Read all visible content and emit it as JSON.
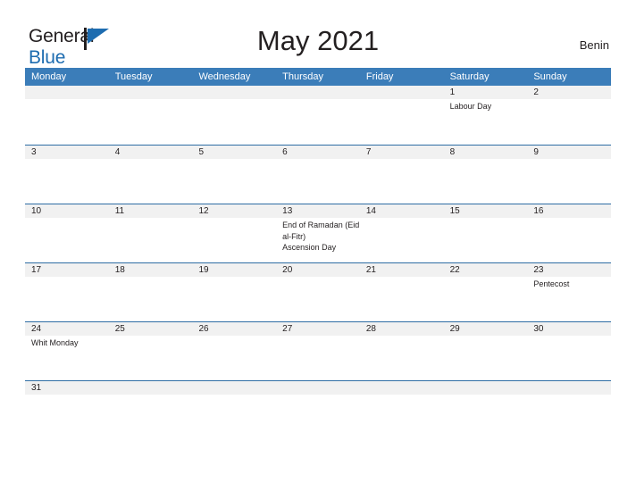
{
  "brand": {
    "name_part1": "General",
    "name_part2": "Blue",
    "logo_icon": "flag-icon",
    "colors": {
      "dark": "#231f20",
      "blue": "#1d6cb0"
    }
  },
  "header": {
    "title": "May 2021",
    "location": "Benin"
  },
  "theme": {
    "header_bar": "#3b7db9",
    "row_divider": "#2e6da4",
    "date_strip": "#f1f1f1",
    "text": "#231f20",
    "page_background": "#ffffff"
  },
  "calendar": {
    "month": "May",
    "year": "2021",
    "weekday_headers": [
      "Monday",
      "Tuesday",
      "Wednesday",
      "Thursday",
      "Friday",
      "Saturday",
      "Sunday"
    ],
    "weeks": [
      {
        "short": false,
        "days": [
          {
            "num": "",
            "event": ""
          },
          {
            "num": "",
            "event": ""
          },
          {
            "num": "",
            "event": ""
          },
          {
            "num": "",
            "event": ""
          },
          {
            "num": "",
            "event": ""
          },
          {
            "num": "1",
            "event": "Labour Day"
          },
          {
            "num": "2",
            "event": ""
          }
        ]
      },
      {
        "short": false,
        "days": [
          {
            "num": "3",
            "event": ""
          },
          {
            "num": "4",
            "event": ""
          },
          {
            "num": "5",
            "event": ""
          },
          {
            "num": "6",
            "event": ""
          },
          {
            "num": "7",
            "event": ""
          },
          {
            "num": "8",
            "event": ""
          },
          {
            "num": "9",
            "event": ""
          }
        ]
      },
      {
        "short": false,
        "days": [
          {
            "num": "10",
            "event": ""
          },
          {
            "num": "11",
            "event": ""
          },
          {
            "num": "12",
            "event": ""
          },
          {
            "num": "13",
            "event": "End of Ramadan (Eid al-Fitr)\n Ascension Day"
          },
          {
            "num": "14",
            "event": ""
          },
          {
            "num": "15",
            "event": ""
          },
          {
            "num": "16",
            "event": ""
          }
        ]
      },
      {
        "short": false,
        "days": [
          {
            "num": "17",
            "event": ""
          },
          {
            "num": "18",
            "event": ""
          },
          {
            "num": "19",
            "event": ""
          },
          {
            "num": "20",
            "event": ""
          },
          {
            "num": "21",
            "event": ""
          },
          {
            "num": "22",
            "event": ""
          },
          {
            "num": "23",
            "event": "Pentecost"
          }
        ]
      },
      {
        "short": false,
        "days": [
          {
            "num": "24",
            "event": "Whit Monday"
          },
          {
            "num": "25",
            "event": ""
          },
          {
            "num": "26",
            "event": ""
          },
          {
            "num": "27",
            "event": ""
          },
          {
            "num": "28",
            "event": ""
          },
          {
            "num": "29",
            "event": ""
          },
          {
            "num": "30",
            "event": ""
          }
        ]
      },
      {
        "short": true,
        "days": [
          {
            "num": "31",
            "event": ""
          },
          {
            "num": "",
            "event": ""
          },
          {
            "num": "",
            "event": ""
          },
          {
            "num": "",
            "event": ""
          },
          {
            "num": "",
            "event": ""
          },
          {
            "num": "",
            "event": ""
          },
          {
            "num": "",
            "event": ""
          }
        ]
      }
    ]
  }
}
